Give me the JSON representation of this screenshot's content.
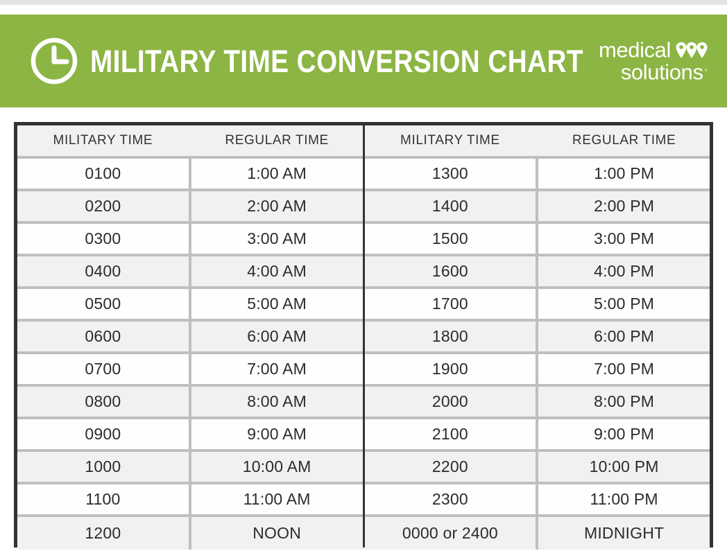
{
  "header": {
    "title": "MILITARY TIME CONVERSION CHART",
    "clock_icon": "clock-icon",
    "brand": {
      "line1": "medical",
      "line2": "solutions",
      "registered_mark": "°",
      "pins_icon": "map-pins-icon"
    },
    "background_color": "#8cb543"
  },
  "table": {
    "columns": [
      "MILITARY TIME",
      "REGULAR TIME",
      "MILITARY TIME",
      "REGULAR TIME"
    ],
    "rows": [
      {
        "am_military": "0100",
        "am_regular": "1:00 AM",
        "pm_military": "1300",
        "pm_regular": "1:00 PM"
      },
      {
        "am_military": "0200",
        "am_regular": "2:00 AM",
        "pm_military": "1400",
        "pm_regular": "2:00 PM"
      },
      {
        "am_military": "0300",
        "am_regular": "3:00 AM",
        "pm_military": "1500",
        "pm_regular": "3:00 PM"
      },
      {
        "am_military": "0400",
        "am_regular": "4:00 AM",
        "pm_military": "1600",
        "pm_regular": "4:00 PM"
      },
      {
        "am_military": "0500",
        "am_regular": "5:00 AM",
        "pm_military": "1700",
        "pm_regular": "5:00 PM"
      },
      {
        "am_military": "0600",
        "am_regular": "6:00 AM",
        "pm_military": "1800",
        "pm_regular": "6:00 PM"
      },
      {
        "am_military": "0700",
        "am_regular": "7:00 AM",
        "pm_military": "1900",
        "pm_regular": "7:00 PM"
      },
      {
        "am_military": "0800",
        "am_regular": "8:00 AM",
        "pm_military": "2000",
        "pm_regular": "8:00 PM"
      },
      {
        "am_military": "0900",
        "am_regular": "9:00 AM",
        "pm_military": "2100",
        "pm_regular": "9:00 PM"
      },
      {
        "am_military": "1000",
        "am_regular": "10:00 AM",
        "pm_military": "2200",
        "pm_regular": "10:00 PM"
      },
      {
        "am_military": "1100",
        "am_regular": "11:00 AM",
        "pm_military": "2300",
        "pm_regular": "11:00 PM"
      },
      {
        "am_military": "1200",
        "am_regular": "NOON",
        "pm_military": "0000 or 2400",
        "pm_regular": "MIDNIGHT"
      }
    ]
  }
}
